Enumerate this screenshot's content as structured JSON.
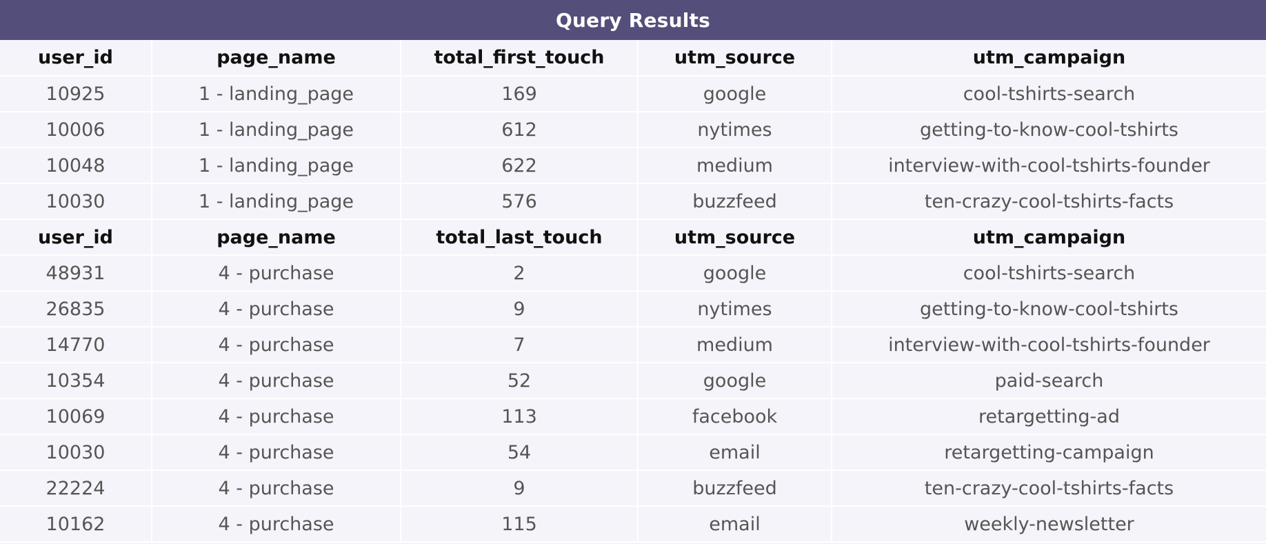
{
  "title": "Query Results",
  "first_touch": {
    "headers": [
      "user_id",
      "page_name",
      "total_first_touch",
      "utm_source",
      "utm_campaign"
    ],
    "rows": [
      [
        "10925",
        "1 - landing_page",
        "169",
        "google",
        "cool-tshirts-search"
      ],
      [
        "10006",
        "1 - landing_page",
        "612",
        "nytimes",
        "getting-to-know-cool-tshirts"
      ],
      [
        "10048",
        "1 - landing_page",
        "622",
        "medium",
        "interview-with-cool-tshirts-founder"
      ],
      [
        "10030",
        "1 - landing_page",
        "576",
        "buzzfeed",
        "ten-crazy-cool-tshirts-facts"
      ]
    ]
  },
  "last_touch": {
    "headers": [
      "user_id",
      "page_name",
      "total_last_touch",
      "utm_source",
      "utm_campaign"
    ],
    "rows": [
      [
        "48931",
        "4 - purchase",
        "2",
        "google",
        "cool-tshirts-search"
      ],
      [
        "26835",
        "4 - purchase",
        "9",
        "nytimes",
        "getting-to-know-cool-tshirts"
      ],
      [
        "14770",
        "4 - purchase",
        "7",
        "medium",
        "interview-with-cool-tshirts-founder"
      ],
      [
        "10354",
        "4 - purchase",
        "52",
        "google",
        "paid-search"
      ],
      [
        "10069",
        "4 - purchase",
        "113",
        "facebook",
        "retargetting-ad"
      ],
      [
        "10030",
        "4 - purchase",
        "54",
        "email",
        "retargetting-campaign"
      ],
      [
        "22224",
        "4 - purchase",
        "9",
        "buzzfeed",
        "ten-crazy-cool-tshirts-facts"
      ],
      [
        "10162",
        "4 - purchase",
        "115",
        "email",
        "weekly-newsletter"
      ]
    ]
  },
  "colors": {
    "title_bar": "#544e7a",
    "background": "#f5f4fa",
    "header_text": "#111111",
    "cell_text": "#555555"
  }
}
